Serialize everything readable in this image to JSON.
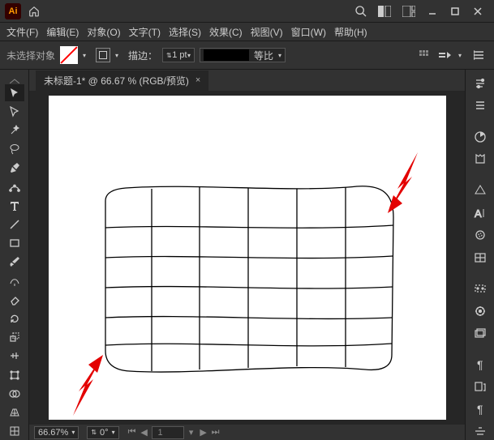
{
  "app": {
    "logo": "Ai"
  },
  "menus": [
    "文件(F)",
    "编辑(E)",
    "对象(O)",
    "文字(T)",
    "选择(S)",
    "效果(C)",
    "视图(V)",
    "窗口(W)",
    "帮助(H)"
  ],
  "control": {
    "noselect": "未选择对象",
    "stroke_label": "描边：",
    "stroke_value": "1 pt",
    "scale_label": "等比"
  },
  "document": {
    "tab_title": "未标题-1* @ 66.67 % (RGB/预览)"
  },
  "status": {
    "zoom": "66.67%",
    "rotation": "0°",
    "page": "1"
  },
  "tools": {
    "left": [
      "selection",
      "direct-select",
      "wand",
      "lasso",
      "pen",
      "curvature",
      "type",
      "line",
      "rect",
      "brush",
      "shaper",
      "eraser",
      "rotate",
      "scale",
      "free-transform",
      "perspective",
      "mesh"
    ],
    "right": [
      "properties",
      "libraries",
      "color",
      "color-guide",
      "swatches",
      "brushes",
      "symbols",
      "stroke",
      "transparency",
      "appearance",
      "graphic-styles",
      "layers",
      "artboards",
      "links"
    ]
  }
}
